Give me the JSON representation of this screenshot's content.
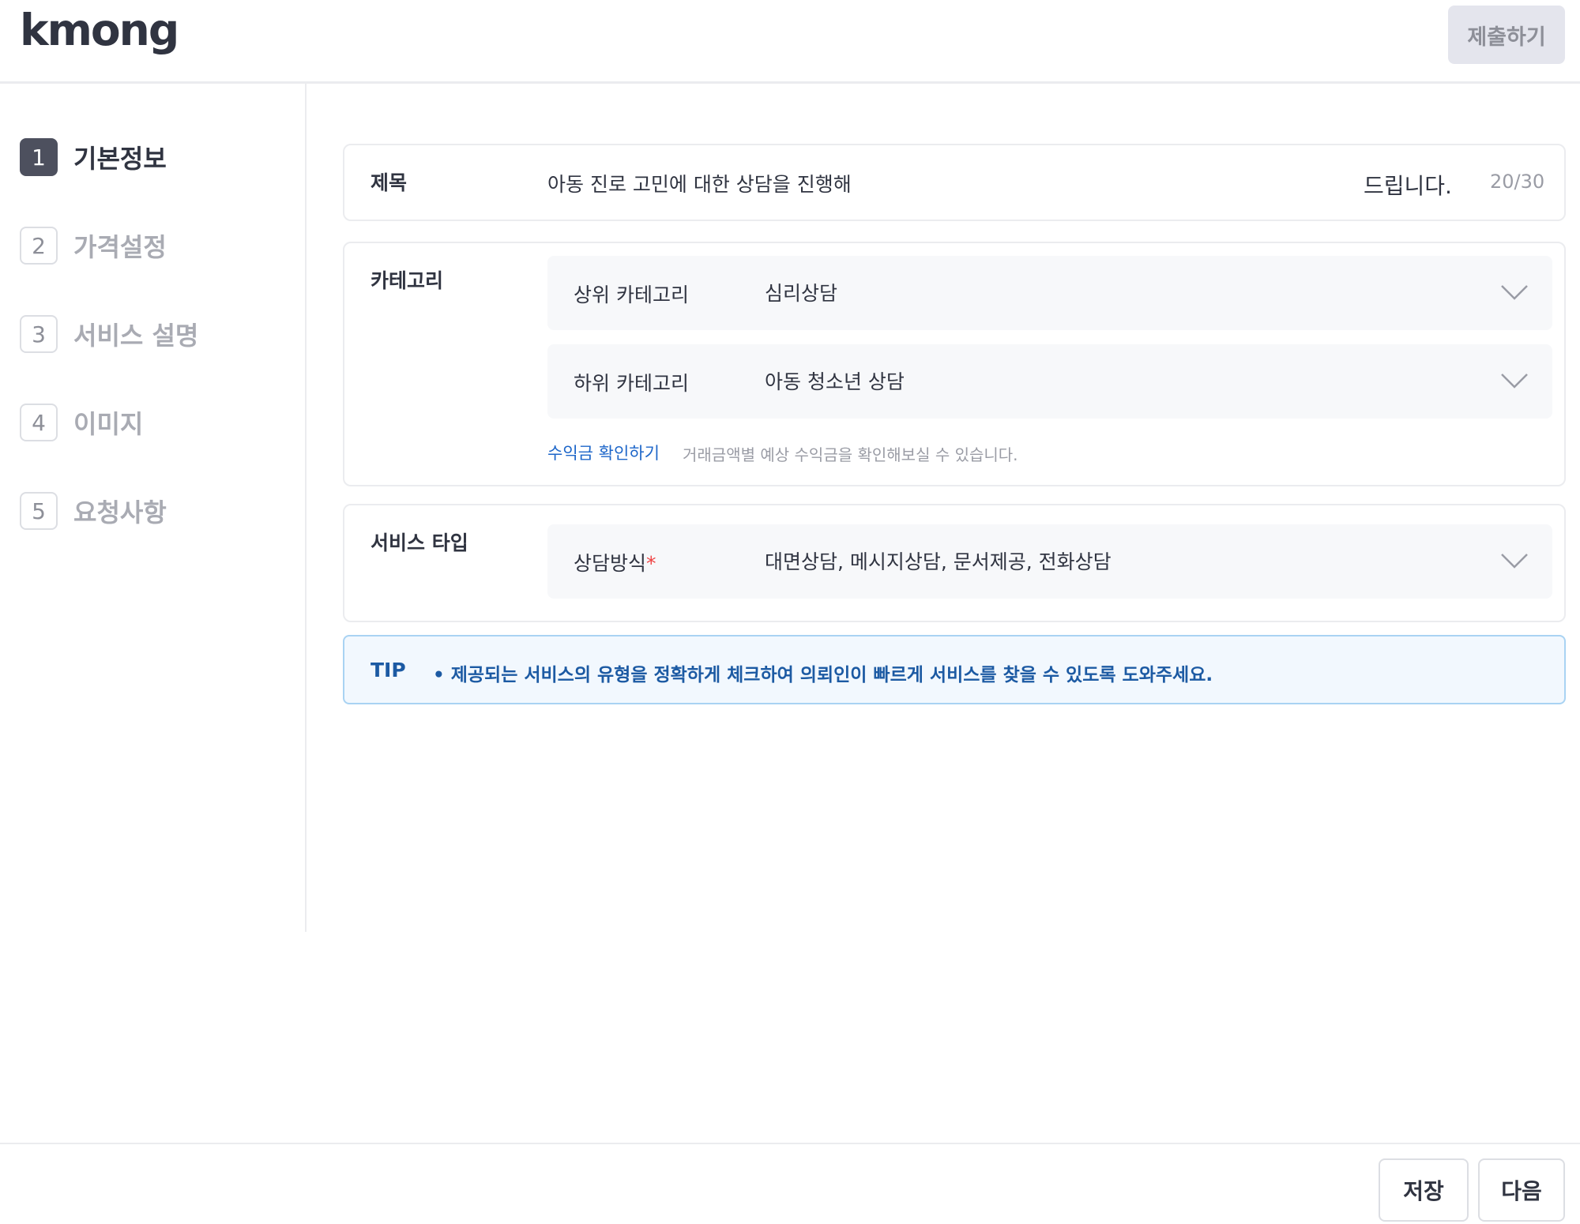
{
  "header": {
    "logo": "kmong",
    "submit_label": "제출하기"
  },
  "sidebar": {
    "steps": [
      {
        "num": "1",
        "label": "기본정보",
        "active": true
      },
      {
        "num": "2",
        "label": "가격설정",
        "active": false
      },
      {
        "num": "3",
        "label": "서비스 설명",
        "active": false
      },
      {
        "num": "4",
        "label": "이미지",
        "active": false
      },
      {
        "num": "5",
        "label": "요청사항",
        "active": false
      }
    ]
  },
  "title_section": {
    "label": "제목",
    "value": "아동 진로 고민에 대한 상담을 진행해",
    "suffix": "드립니다.",
    "count": "20/30"
  },
  "category_section": {
    "label": "카테고리",
    "parent": {
      "label": "상위 카테고리",
      "value": "심리상담"
    },
    "child": {
      "label": "하위 카테고리",
      "value": "아동 청소년 상담"
    },
    "revenue_link": "수익금 확인하기",
    "revenue_desc": "거래금액별 예상 수익금을 확인해보실 수 있습니다."
  },
  "service_section": {
    "label": "서비스 타입",
    "method": {
      "label": "상담방식",
      "required_mark": "*",
      "value": "대면상담, 메시지상담, 문서제공, 전화상담"
    }
  },
  "tip": {
    "label": "TIP",
    "text": "• 제공되는 서비스의 유형을 정확하게 체크하여 의뢰인이 빠르게 서비스를 찾을 수 있도록 도와주세요."
  },
  "footer": {
    "save_label": "저장",
    "next_label": "다음"
  },
  "colors": {
    "accent_link": "#1d66c9",
    "tip_text": "#1c5aa3",
    "tip_bg": "#f2f8fe",
    "active_step": "#4d505e"
  }
}
